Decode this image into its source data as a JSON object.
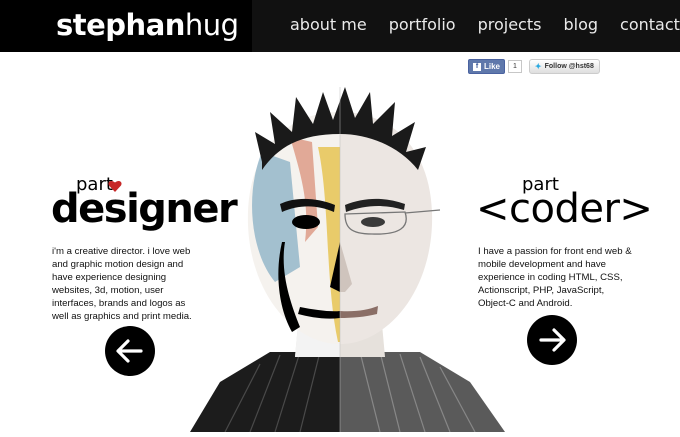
{
  "header": {
    "logo_bold": "stephan",
    "logo_light": "hug",
    "nav": [
      "about me",
      "portfolio",
      "projects",
      "blog",
      "contact me"
    ]
  },
  "social": {
    "fb_label": "Like",
    "fb_count": "1",
    "twitter_label": "Follow @hst68"
  },
  "designer": {
    "small": "part",
    "title": "designer",
    "text": "i'm a creative director. i love web and graphic motion design and have experience designing websites, 3d, motion, user interfaces, brands and logos as well as graphics and print media."
  },
  "coder": {
    "small": "part",
    "title": "<coder>",
    "text": "I have a passion for front end web & mobile development and have experience in coding HTML, CSS, Actionscript, PHP, JavaScript, Object-C and Android."
  },
  "colors": {
    "heart": "#c62828",
    "topbar": "#111111"
  },
  "icons": [
    "facebook-icon",
    "twitter-icon",
    "heart-icon",
    "arrow-left-icon",
    "arrow-right-icon"
  ]
}
